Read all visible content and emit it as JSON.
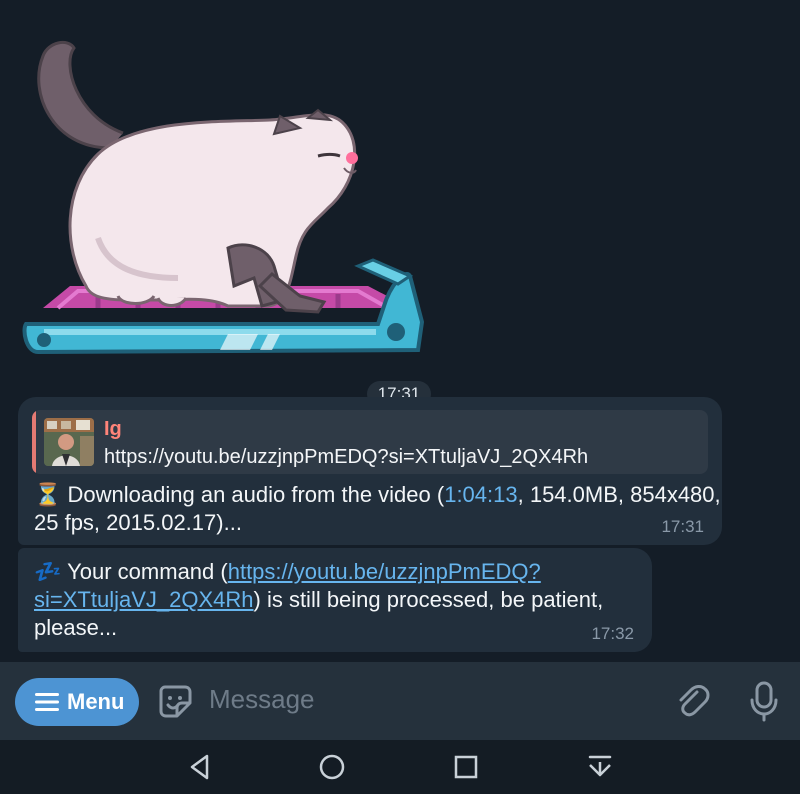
{
  "sticker": {
    "name": "cat-on-treadmill-sticker",
    "time": "17:31"
  },
  "messages": [
    {
      "reply": {
        "author": "Ig",
        "text": "https://youtu.be/uzzjnpPmEDQ?si=XTtuljaVJ_2QX4Rh"
      },
      "icon": "⏳",
      "text_before": " Downloading an audio from the video (",
      "duration": "1:04:13",
      "text_after": ", 154.0MB, 854x480, 25 fps, 2015.02.17)...",
      "time": "17:31"
    },
    {
      "icon": "💤",
      "text_before": " Your command (",
      "link": "https://youtu.be/uzzjnpPmEDQ?si=XTtuljaVJ_2QX4Rh",
      "text_after": ") is still being processed, be patient, please...",
      "time": "17:32"
    }
  ],
  "composer": {
    "menu_label": "Menu",
    "placeholder": "Message"
  },
  "colors": {
    "background": "#141d27",
    "bubble": "#222f3c",
    "accent": "#4d94d3",
    "link": "#67b5ee",
    "reply_name": "#ff8479"
  }
}
